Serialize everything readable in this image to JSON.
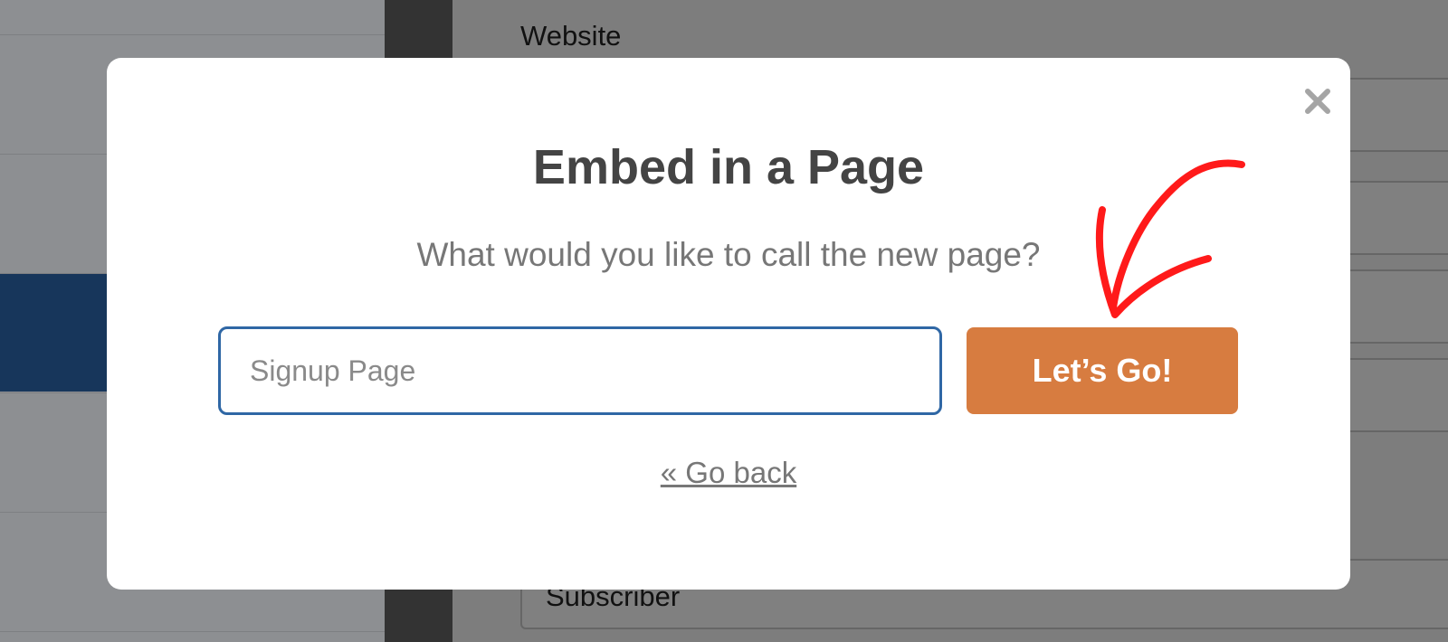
{
  "background": {
    "website_label": "Website",
    "subscriber_value": "Subscriber"
  },
  "modal": {
    "title": "Embed in a Page",
    "question": "What would you like to call the new page?",
    "input": {
      "value": "",
      "placeholder": "Signup Page"
    },
    "submit_label": "Let’s Go!",
    "back_label": "« Go back",
    "close_icon": "close-icon"
  },
  "colors": {
    "accent_orange": "#d77c40",
    "input_border": "#2f67a5",
    "annotation_red": "#ff1a1a",
    "sidebar_active": "#17365b"
  }
}
